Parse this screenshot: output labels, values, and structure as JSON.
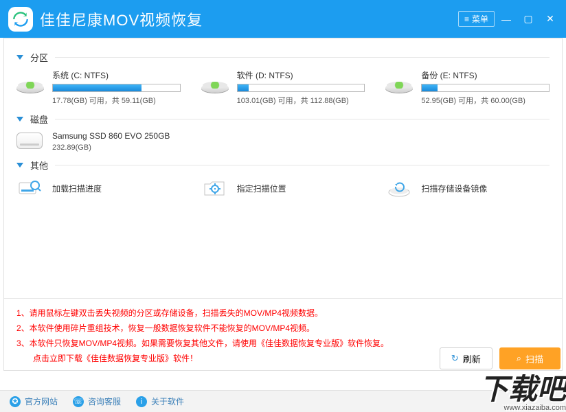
{
  "titlebar": {
    "app_title": "佳佳尼康MOV视频恢复",
    "menu_label": "菜单"
  },
  "sections": {
    "partitions_label": "分区",
    "disks_label": "磁盘",
    "others_label": "其他"
  },
  "partitions": [
    {
      "name": "系统 (C: NTFS)",
      "free": "17.78(GB) 可用，共 59.11(GB)",
      "fill_pct": 70
    },
    {
      "name": "软件 (D: NTFS)",
      "free": "103.01(GB) 可用，共 112.88(GB)",
      "fill_pct": 9
    },
    {
      "name": "备份 (E: NTFS)",
      "free": "52.95(GB) 可用，共 60.00(GB)",
      "fill_pct": 12
    }
  ],
  "disks": [
    {
      "name": "Samsung SSD 860 EVO 250GB",
      "size": "232.89(GB)"
    }
  ],
  "others": [
    {
      "id": "load-progress",
      "label": "加载扫描进度"
    },
    {
      "id": "specify-location",
      "label": "指定扫描位置"
    },
    {
      "id": "scan-image",
      "label": "扫描存储设备镜像"
    }
  ],
  "notes": {
    "n1": "1、请用鼠标左键双击丢失视频的分区或存储设备，扫描丢失的MOV/MP4视频数据。",
    "n2": "2、本软件使用碎片重组技术，恢复一般数据恢复软件不能恢复的MOV/MP4视频。",
    "n3a": "3、本软件只恢复MOV/MP4视频。如果需要恢复其他文件，请使用《佳佳数据恢复专业版》软件恢复。",
    "n3b": "点击立即下载《佳佳数据恢复专业版》软件！"
  },
  "actions": {
    "refresh": "刷新",
    "scan": "扫描"
  },
  "footer": {
    "website": "官方网站",
    "support": "咨询客服",
    "about": "关于软件"
  },
  "watermark": {
    "text": "下载吧",
    "sub": "www.xiazaiba.com"
  }
}
